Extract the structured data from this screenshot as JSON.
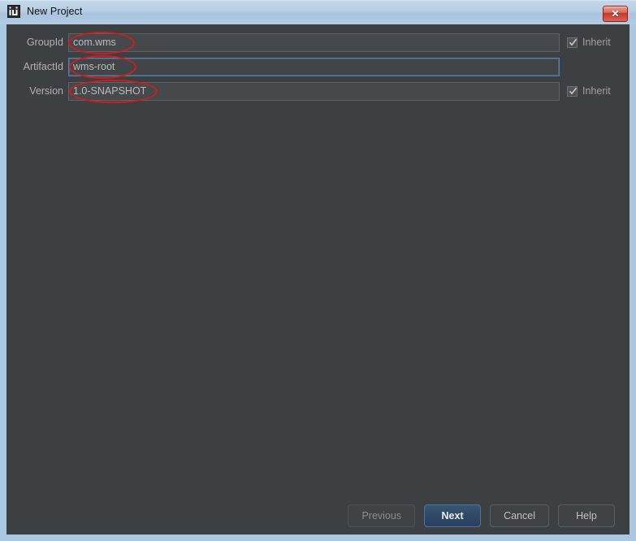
{
  "window": {
    "title": "New Project",
    "icon": "intellij-idea-icon",
    "close_label": "✕",
    "frame_color": "#aac8e2",
    "content_bg": "#3c4043",
    "titlebar_color": "#b5cde4"
  },
  "form": {
    "fields": [
      {
        "label": "GroupId",
        "value": "com.wms",
        "placeholder": "",
        "focused": false,
        "annotated": true,
        "inherit": {
          "label": "Inherit",
          "checked": true,
          "visible": true
        }
      },
      {
        "label": "ArtifactId",
        "value": "wms-root",
        "placeholder": "",
        "focused": true,
        "annotated": true,
        "inherit": {
          "label": "",
          "checked": false,
          "visible": false
        }
      },
      {
        "label": "Version",
        "value": "1.0-SNAPSHOT",
        "placeholder": "",
        "focused": false,
        "annotated": true,
        "inherit": {
          "label": "Inherit",
          "checked": true,
          "visible": true
        }
      }
    ]
  },
  "annotations": {
    "color": "#cc1e1e",
    "shape": "ellipse",
    "targets": [
      "com.wms",
      "wms-root",
      "1.0-SNAPSHOT"
    ]
  },
  "buttons": {
    "previous": "Previous",
    "next": "Next",
    "cancel": "Cancel",
    "help": "Help"
  }
}
